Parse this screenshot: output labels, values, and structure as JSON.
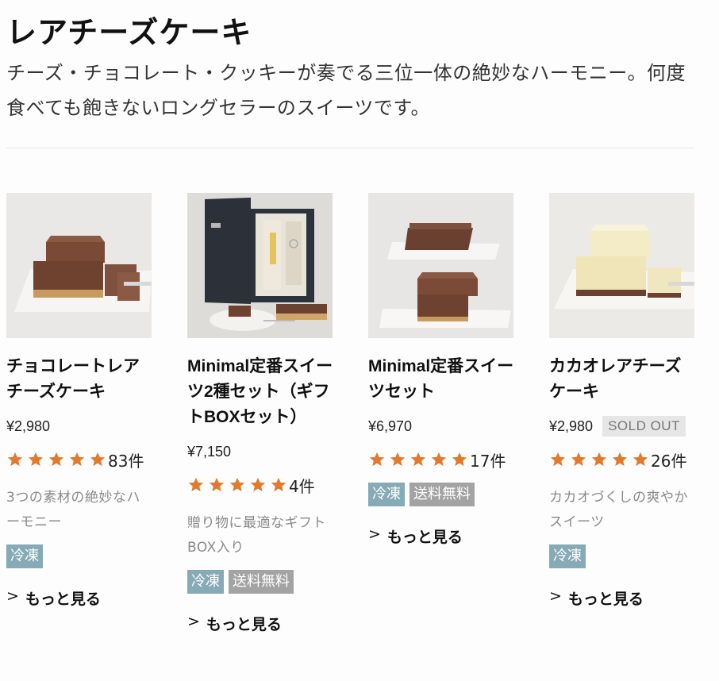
{
  "page": {
    "title": "レアチーズケーキ",
    "description": "チーズ・チョコレート・クッキーが奏でる三位一体の絶妙なハーモニー。何度食べても飽きないロングセラーのスイーツです。"
  },
  "colors": {
    "star": "#e07a2e",
    "frozen_tag": "#86aab6",
    "shipping_tag": "#a3a3a3",
    "soldout_bg": "#e6e6e6"
  },
  "products": [
    {
      "name": "チョコレートレアチーズケーキ",
      "price": "¥2,980",
      "rating": 5,
      "review_count": "83件",
      "note": "3つの素材の絶妙なハーモニー",
      "tags": [
        "冷凍"
      ],
      "more_label": "もっと見る",
      "arrow": ">"
    },
    {
      "name": "Minimal定番スイーツ2種セット（ギフトBOXセット）",
      "price": "¥7,150",
      "rating": 5,
      "review_count": "4件",
      "note": "贈り物に最適なギフトBOX入り",
      "tags": [
        "冷凍",
        "送料無料"
      ],
      "more_label": "もっと見る",
      "arrow": ">"
    },
    {
      "name": "Minimal定番スイーツセット",
      "price": "¥6,970",
      "rating": 5,
      "review_count": "17件",
      "tags": [
        "冷凍",
        "送料無料"
      ],
      "more_label": "もっと見る",
      "arrow": ">"
    },
    {
      "name": "カカオレアチーズケーキ",
      "price": "¥2,980",
      "sold_out": "SOLD OUT",
      "rating": 5,
      "review_count": "26件",
      "note": "カカオづくしの爽やかスイーツ",
      "tags": [
        "冷凍"
      ],
      "more_label": "もっと見る",
      "arrow": ">"
    }
  ]
}
